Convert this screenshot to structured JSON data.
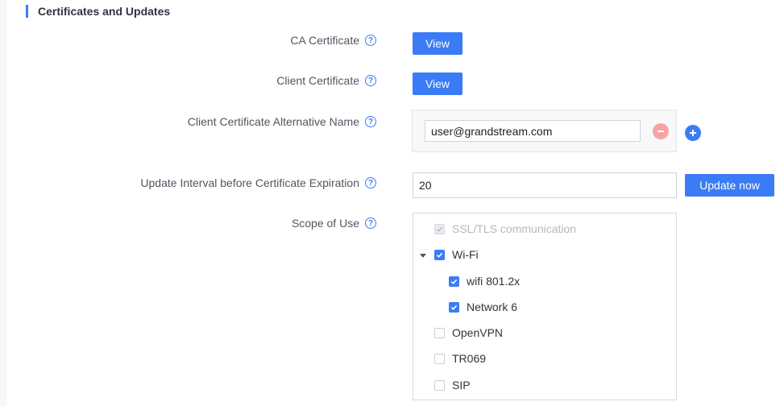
{
  "section": {
    "title": "Certificates and Updates"
  },
  "fields": {
    "ca_certificate": {
      "label": "CA Certificate",
      "button": "View"
    },
    "client_certificate": {
      "label": "Client Certificate",
      "button": "View"
    },
    "alt_name": {
      "label": "Client Certificate Alternative Name",
      "value": "user@grandstream.com"
    },
    "update_interval": {
      "label": "Update Interval before Certificate Expiration",
      "value": "20",
      "button": "Update now"
    },
    "scope": {
      "label": "Scope of Use",
      "items": [
        {
          "label": "SSL/TLS communication",
          "checked": true,
          "disabled": true
        },
        {
          "label": "Wi-Fi",
          "checked": true,
          "expanded": true
        },
        {
          "label": "wifi 801.2x",
          "checked": true
        },
        {
          "label": "Network 6",
          "checked": true
        },
        {
          "label": "OpenVPN",
          "checked": false
        },
        {
          "label": "TR069",
          "checked": false
        },
        {
          "label": "SIP",
          "checked": false
        }
      ]
    }
  },
  "icons": {
    "help": "question-circle-icon",
    "remove": "minus-circle-icon",
    "add": "plus-circle-icon",
    "check": "check-icon",
    "caret": "caret-down-icon"
  },
  "colors": {
    "accent": "#3b7cf6",
    "remove": "#f5a3a3",
    "text": "#505660",
    "disabled_text": "#b4b8bf"
  }
}
